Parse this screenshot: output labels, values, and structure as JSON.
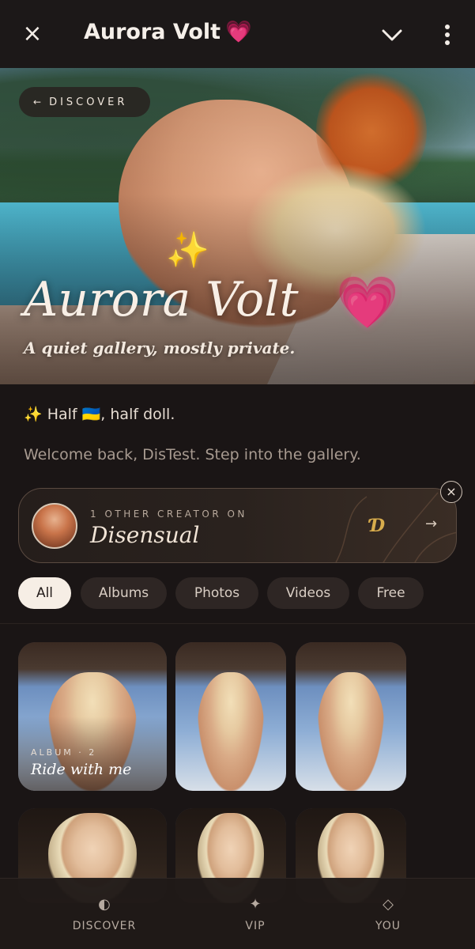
{
  "header": {
    "close_icon": "×",
    "title": "Aurora Volt",
    "title_emoji": "💗"
  },
  "hero": {
    "back_arrow": "←",
    "back_label": "DISCOVER",
    "title": "Aurora Volt",
    "sparkles": "✨",
    "heart": "💗",
    "subtitle": "A quiet gallery, mostly private."
  },
  "bio": {
    "sparkle": "✨",
    "text": " Half 🇺🇦, half doll.",
    "welcome": "Welcome back, DisTest. Step into the gallery."
  },
  "creator_card": {
    "eyebrow": "1 OTHER CREATOR ON",
    "brand": "Disensual",
    "logo": "Ɗ",
    "arrow": "→",
    "close": "×"
  },
  "filters": {
    "tabs": [
      "All",
      "Albums",
      "Photos",
      "Videos",
      "Free"
    ],
    "active": "All"
  },
  "grid": {
    "tiles": [
      {
        "eyebrow": "ALBUM · 2",
        "title": "Ride with me"
      }
    ]
  },
  "bottom_nav": {
    "items": [
      {
        "icon": "◐",
        "label": "DISCOVER"
      },
      {
        "icon": "✦",
        "label": "VIP"
      },
      {
        "icon": "◇",
        "label": "YOU"
      }
    ]
  },
  "colors": {
    "background": "#1a1515",
    "accent": "#f6eee5",
    "heart": "#ff4fa3",
    "gold": "#d7ac4c"
  }
}
